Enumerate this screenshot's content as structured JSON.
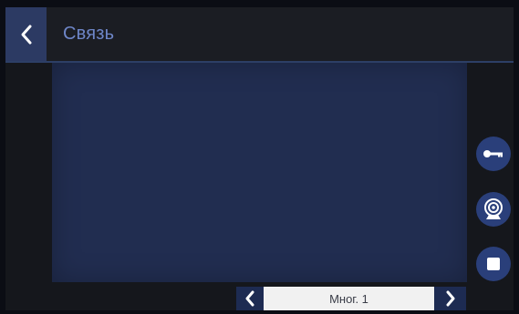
{
  "header": {
    "title": "Связь",
    "back_icon": "chevron-left-icon"
  },
  "side_actions": [
    {
      "name": "key-button",
      "icon": "key-icon"
    },
    {
      "name": "camera-button",
      "icon": "webcam-icon"
    },
    {
      "name": "stop-button",
      "icon": "stop-icon"
    }
  ],
  "bottom_nav": {
    "current_value": "Мног. 1",
    "prev_icon": "chevron-left-icon",
    "next_icon": "chevron-right-icon"
  },
  "colors": {
    "accent": "#2c3a63",
    "title": "#6e86c8",
    "video_background": "#212d50",
    "button": "#2a3f7a"
  }
}
